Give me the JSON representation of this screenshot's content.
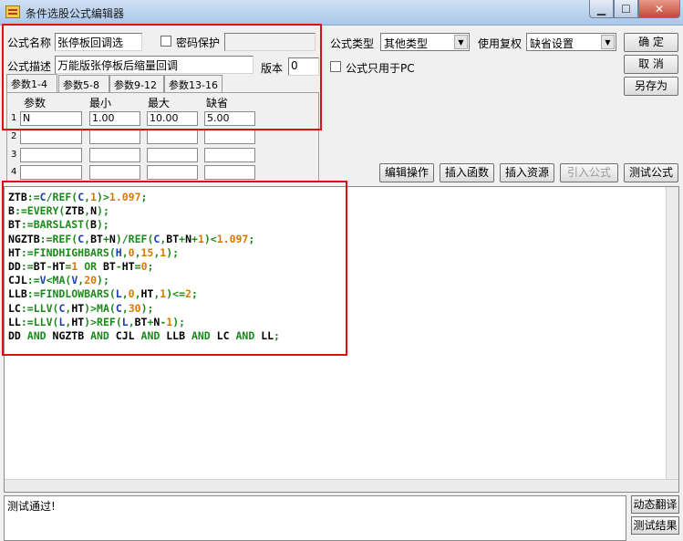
{
  "window": {
    "title": "条件选股公式编辑器"
  },
  "form": {
    "name_label": "公式名称",
    "name_value": "张停板回调选",
    "password_label": "密码保护",
    "desc_label": "公式描述",
    "desc_value": "万能版张停板后缩量回调",
    "version_label": "版本",
    "version_value": "0",
    "type_label": "公式类型",
    "type_value": "其他类型",
    "reright_label": "使用复权",
    "reright_value": "缺省设置",
    "pc_only_label": "公式只用于PC"
  },
  "buttons": {
    "ok": "确  定",
    "cancel": "取  消",
    "save_as": "另存为",
    "edit_ops": "编辑操作",
    "insert_func": "插入函数",
    "insert_res": "插入资源",
    "import_formula": "引入公式",
    "test_formula": "测试公式",
    "dynamic_translate": "动态翻译",
    "test_result": "测试结果"
  },
  "tabs": [
    "参数1-4",
    "参数5-8",
    "参数9-12",
    "参数13-16"
  ],
  "params": {
    "headers": [
      "参数",
      "最小",
      "最大",
      "缺省"
    ],
    "rows": [
      {
        "num": "1",
        "name": "N",
        "min": "1.00",
        "max": "10.00",
        "default": "5.00"
      },
      {
        "num": "2",
        "name": "",
        "min": "",
        "max": "",
        "default": ""
      },
      {
        "num": "3",
        "name": "",
        "min": "",
        "max": "",
        "default": ""
      },
      {
        "num": "4",
        "name": "",
        "min": "",
        "max": "",
        "default": ""
      }
    ]
  },
  "code_lines": [
    "ZTB:=C/REF(C,1)>1.097;",
    "B:=EVERY(ZTB,N);",
    "BT:=BARSLAST(B);",
    "NGZTB:=REF(C,BT+N)/REF(C,BT+N+1)<1.097;",
    "HT:=FINDHIGHBARS(H,0,15,1);",
    "DD:=BT-HT=1 OR BT-HT=0;",
    "CJL:=V<MA(V,20);",
    "LLB:=FINDLOWBARS(L,0,HT,1)<=2;",
    "LC:=LLV(C,HT)>MA(C,30);",
    "LL:=LLV(L,HT)>REF(L,BT+N-1);",
    "DD AND NGZTB AND CJL AND LLB AND LC AND LL;"
  ],
  "output": {
    "text": "测试通过!"
  },
  "colors": {
    "keyword": "#000000",
    "function": "#1a8a1a",
    "variable_price": "#1a3fb0",
    "number": "#d77a00",
    "highlight": "#e01010"
  }
}
